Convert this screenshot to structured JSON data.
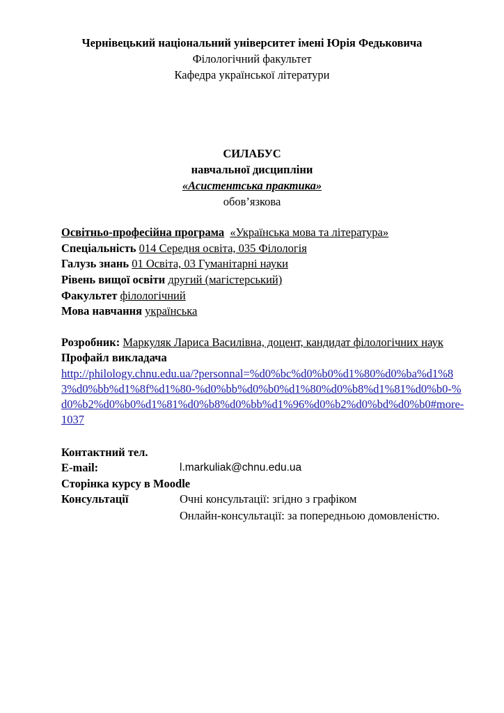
{
  "header": {
    "university": "Чернівецький національний університет імені Юрія Федьковича",
    "faculty": "Філологічний факультет",
    "department": "Кафедра української літератури"
  },
  "title": {
    "doc_type": "СИЛАБУС",
    "subtitle": "навчальної дисципліни",
    "course": "«Асистентська практика»",
    "status": "обов’язкова"
  },
  "info": {
    "program_label": "Освітньо-професійна програма",
    "program_value": "«Українська мова та література»",
    "specialty_label": "Спеціальність",
    "specialty_value": "014 Середня освіта, 035 Філологія",
    "field_label": "Галузь знань",
    "field_value": "01 Освіта, 03 Гуманітарні науки",
    "level_label": "Рівень вищої освіти",
    "level_value": "другий (магістерський)",
    "faculty_label": "Факультет",
    "faculty_value": "філологічний",
    "language_label": "Мова навчання",
    "language_value": "українська"
  },
  "developer": {
    "label": "Розробник:",
    "value": "Маркуляк Лариса Василівна, доцент, кандидат філологічних наук",
    "profile_label": "Профайл викладача",
    "profile_url": "http://philology.chnu.edu.ua/?personnal=%d0%bc%d0%b0%d1%80%d0%ba%d1%83%d0%bb%d1%8f%d1%80-%d0%bb%d0%b0%d1%80%d0%b8%d1%81%d0%b0-%d0%b2%d0%b0%d1%81%d0%b8%d0%bb%d1%96%d0%b2%d0%bd%d0%b0#more-1037"
  },
  "contacts": {
    "phone_label": "Контактний тел.",
    "email_label": "E-mail:",
    "email_value": "l.markuliak@chnu.edu.ua",
    "moodle_label": "Сторінка курсу в Moodle",
    "consult_label": "Консультації",
    "consult_offline": "Очні консультації: згідно з графіком",
    "consult_online": "Онлайн-консультації: за попередньою домовленістю."
  },
  "colors": {
    "link": "#1a1aa6",
    "text": "#000000"
  }
}
